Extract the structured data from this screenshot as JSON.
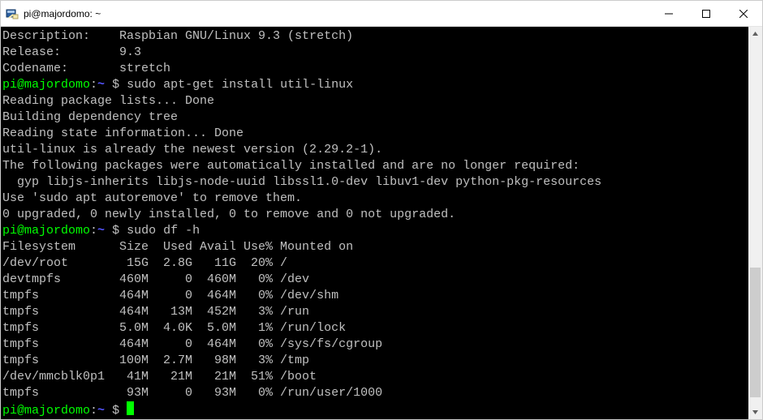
{
  "window": {
    "title": "pi@majordomo: ~"
  },
  "prompt": {
    "user_host": "pi@majordomo",
    "colon": ":",
    "path": "~",
    "dollar": " $ "
  },
  "header_lines": [
    "Description:    Raspbian GNU/Linux 9.3 (stretch)",
    "Release:        9.3",
    "Codename:       stretch"
  ],
  "cmd1": "sudo apt-get install util-linux",
  "apt_output": [
    "Reading package lists... Done",
    "Building dependency tree",
    "Reading state information... Done",
    "util-linux is already the newest version (2.29.2-1).",
    "The following packages were automatically installed and are no longer required:",
    "  gyp libjs-inherits libjs-node-uuid libssl1.0-dev libuv1-dev python-pkg-resources",
    "Use 'sudo apt autoremove' to remove them.",
    "0 upgraded, 0 newly installed, 0 to remove and 0 not upgraded."
  ],
  "cmd2": "sudo df -h",
  "df": {
    "header": {
      "fs": "Filesystem",
      "size": "Size",
      "used": "Used",
      "avail": "Avail",
      "use": "Use%",
      "mount": "Mounted on"
    },
    "rows": [
      {
        "fs": "/dev/root",
        "size": "15G",
        "used": "2.8G",
        "avail": "11G",
        "use": "20%",
        "mount": "/"
      },
      {
        "fs": "devtmpfs",
        "size": "460M",
        "used": "0",
        "avail": "460M",
        "use": "0%",
        "mount": "/dev"
      },
      {
        "fs": "tmpfs",
        "size": "464M",
        "used": "0",
        "avail": "464M",
        "use": "0%",
        "mount": "/dev/shm"
      },
      {
        "fs": "tmpfs",
        "size": "464M",
        "used": "13M",
        "avail": "452M",
        "use": "3%",
        "mount": "/run"
      },
      {
        "fs": "tmpfs",
        "size": "5.0M",
        "used": "4.0K",
        "avail": "5.0M",
        "use": "1%",
        "mount": "/run/lock"
      },
      {
        "fs": "tmpfs",
        "size": "464M",
        "used": "0",
        "avail": "464M",
        "use": "0%",
        "mount": "/sys/fs/cgroup"
      },
      {
        "fs": "tmpfs",
        "size": "100M",
        "used": "2.7M",
        "avail": "98M",
        "use": "3%",
        "mount": "/tmp"
      },
      {
        "fs": "/dev/mmcblk0p1",
        "size": "41M",
        "used": "21M",
        "avail": "21M",
        "use": "51%",
        "mount": "/boot"
      },
      {
        "fs": "tmpfs",
        "size": "93M",
        "used": "0",
        "avail": "93M",
        "use": "0%",
        "mount": "/run/user/1000"
      }
    ]
  }
}
